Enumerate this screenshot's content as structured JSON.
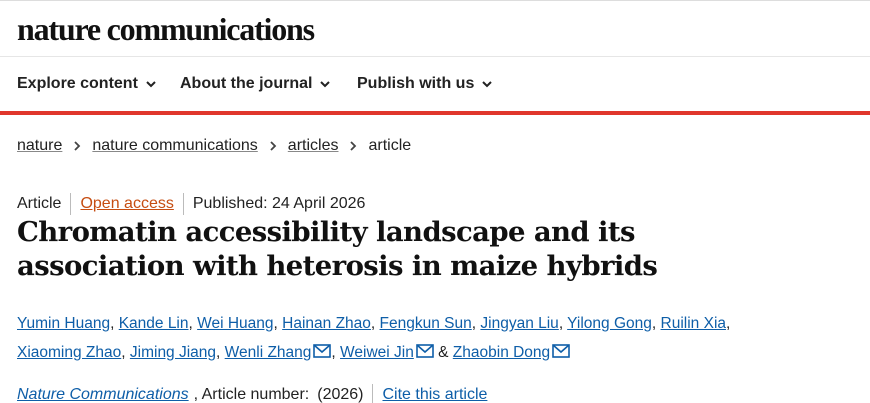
{
  "header": {
    "logo": "nature communications"
  },
  "nav": {
    "items": [
      {
        "label": "Explore content"
      },
      {
        "label": "About the journal"
      },
      {
        "label": "Publish with us"
      }
    ]
  },
  "breadcrumb": {
    "items": [
      "nature",
      "nature communications",
      "articles"
    ],
    "current": "article"
  },
  "article": {
    "type": "Article",
    "access": "Open access",
    "published": "Published: 24 April 2026",
    "title": "Chromatin accessibility landscape and its association with heterosis in maize hybrids",
    "authors": [
      "Yumin Huang",
      "Kande Lin",
      "Wei Huang",
      "Hainan Zhao",
      "Fengkun Sun",
      "Jingyan Liu",
      "Yilong Gong",
      "Ruilin Xia",
      "Xiaoming Zhao",
      "Jiming Jiang",
      "Wenli Zhang",
      "Weiwei Jin",
      "Zhaobin Dong"
    ],
    "and_text": "&",
    "journal": "Nature Communications",
    "article_number_label": ", Article number:",
    "year": "(2026)",
    "cite_label": "Cite this article"
  },
  "colors": {
    "accent_red": "#e0362c",
    "link_blue": "#0e5ea8",
    "open_access": "#c64d11"
  }
}
